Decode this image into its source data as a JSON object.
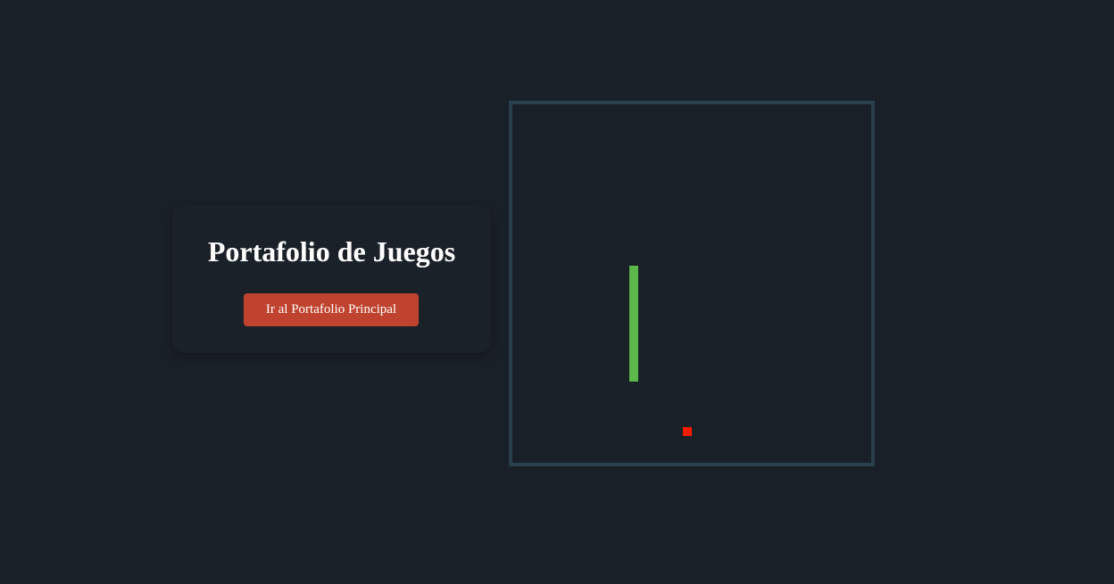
{
  "header": {
    "title": "Portafolio de Juegos",
    "main_portfolio_button_label": "Ir al Portafolio Principal"
  },
  "game": {
    "snake_color": "#5cb84a",
    "food_color": "#ff1a00",
    "board_border_color": "#2a3f4c",
    "background_color": "#1a2027"
  },
  "theme": {
    "button_color": "#c0432f"
  }
}
